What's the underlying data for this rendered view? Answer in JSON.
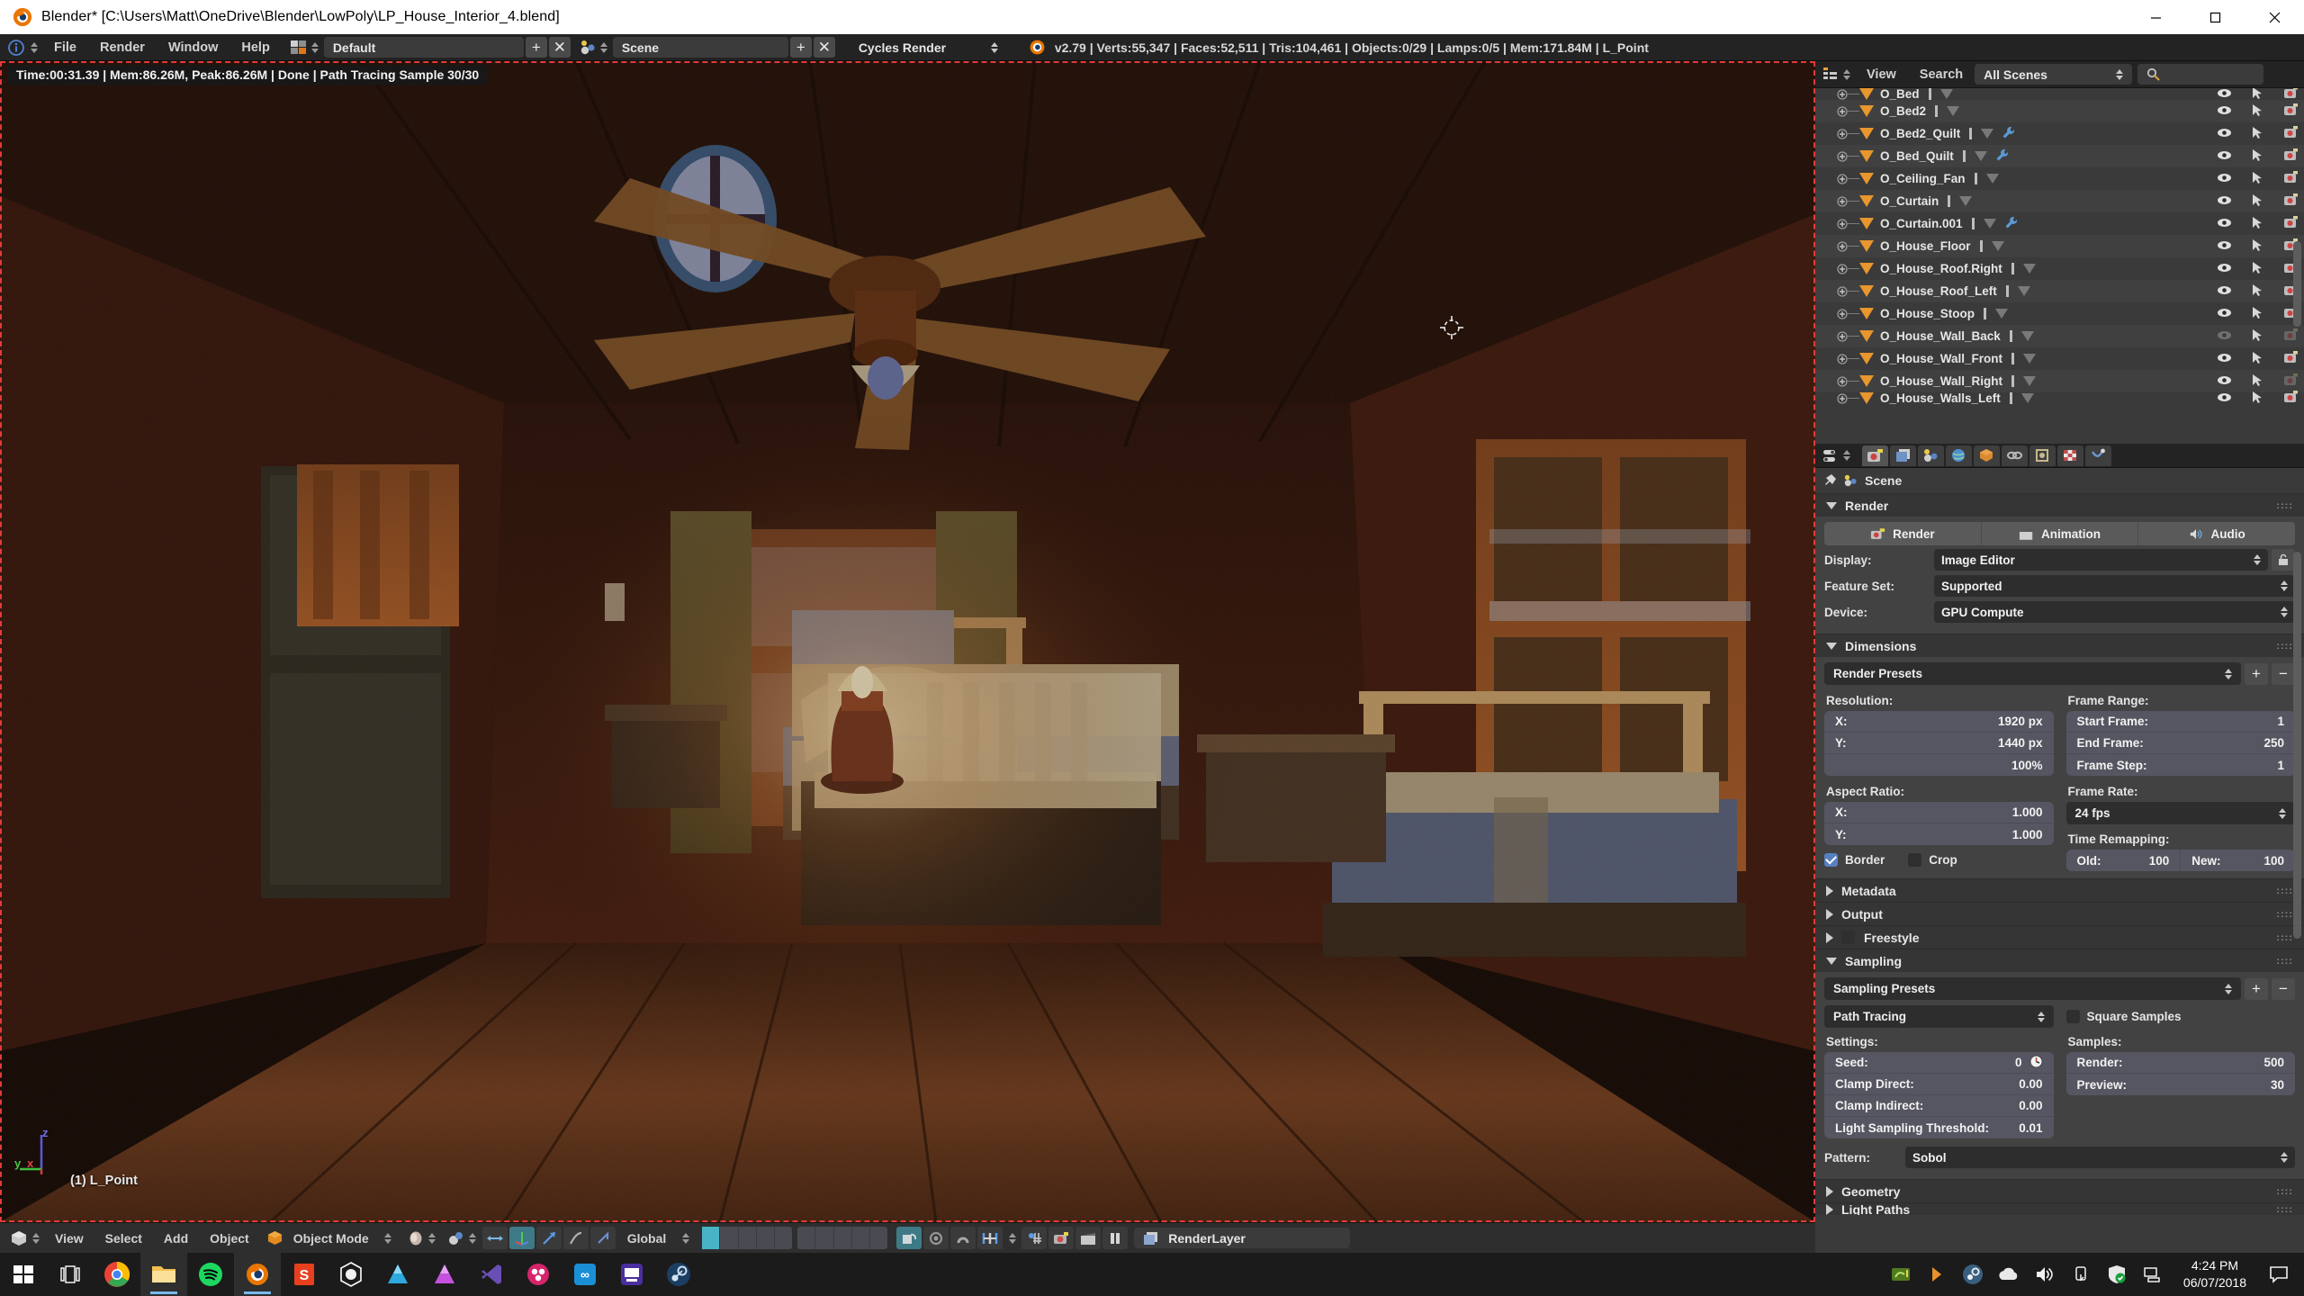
{
  "window": {
    "title": "Blender* [C:\\Users\\Matt\\OneDrive\\Blender\\LowPoly\\LP_House_Interior_4.blend]",
    "minimize": "—",
    "maximize": "☐",
    "close": "✕"
  },
  "topbar": {
    "menus": [
      "File",
      "Render",
      "Window",
      "Help"
    ],
    "screen_layout": "Default",
    "scene": "Scene",
    "engine": "Cycles Render",
    "add_label": "+",
    "remove_label": "✕",
    "stats": "v2.79 | Verts:55,347 | Faces:52,511 | Tris:104,461 | Objects:0/29 | Lamps:0/5 | Mem:171.84M | L_Point"
  },
  "viewport": {
    "render_info": "Time:00:31.39 | Mem:86.26M, Peak:86.26M | Done | Path Tracing Sample 30/30",
    "active_object": "(1) L_Point",
    "axis_labels": {
      "x": "x",
      "y": "y",
      "z": "z"
    },
    "header": {
      "menus": [
        "View",
        "Select",
        "Add",
        "Object"
      ],
      "mode": "Object Mode",
      "orientation": "Global",
      "render_layer": "RenderLayer"
    }
  },
  "outliner": {
    "header": {
      "view": "View",
      "search": "Search",
      "display_mode": "All Scenes",
      "search_placeholder": ""
    },
    "items": [
      {
        "name": "O_Bed",
        "modifier": false,
        "visible": true,
        "selectable": true,
        "renderable": true,
        "partial": true
      },
      {
        "name": "O_Bed2",
        "modifier": false,
        "visible": true,
        "selectable": true,
        "renderable": true
      },
      {
        "name": "O_Bed2_Quilt",
        "modifier": true,
        "visible": true,
        "selectable": true,
        "renderable": true
      },
      {
        "name": "O_Bed_Quilt",
        "modifier": true,
        "visible": true,
        "selectable": true,
        "renderable": true
      },
      {
        "name": "O_Ceiling_Fan",
        "modifier": false,
        "visible": true,
        "selectable": true,
        "renderable": true
      },
      {
        "name": "O_Curtain",
        "modifier": false,
        "visible": true,
        "selectable": true,
        "renderable": true
      },
      {
        "name": "O_Curtain.001",
        "modifier": true,
        "visible": true,
        "selectable": true,
        "renderable": true
      },
      {
        "name": "O_House_Floor",
        "modifier": false,
        "visible": true,
        "selectable": true,
        "renderable": true
      },
      {
        "name": "O_House_Roof.Right",
        "modifier": false,
        "visible": true,
        "selectable": true,
        "renderable": true
      },
      {
        "name": "O_House_Roof_Left",
        "modifier": false,
        "visible": true,
        "selectable": true,
        "renderable": true
      },
      {
        "name": "O_House_Stoop",
        "modifier": false,
        "visible": true,
        "selectable": true,
        "renderable": true
      },
      {
        "name": "O_House_Wall_Back",
        "modifier": false,
        "visible": false,
        "selectable": true,
        "renderable": false
      },
      {
        "name": "O_House_Wall_Front",
        "modifier": false,
        "visible": true,
        "selectable": true,
        "renderable": true
      },
      {
        "name": "O_House_Wall_Right",
        "modifier": false,
        "visible": true,
        "selectable": true,
        "renderable": false
      },
      {
        "name": "O_House_Walls_Left",
        "modifier": false,
        "visible": true,
        "selectable": true,
        "renderable": true,
        "partial": true
      }
    ]
  },
  "properties": {
    "context": "Scene",
    "tabs": [
      "render-tab",
      "render-layers-tab",
      "scene-tab",
      "world-tab",
      "object-tab",
      "constraints-tab",
      "modifiers-tab",
      "texture-tab",
      "physics-tab"
    ],
    "render": {
      "title": "Render",
      "buttons": [
        "Render",
        "Animation",
        "Audio"
      ],
      "display_label": "Display:",
      "display_value": "Image Editor",
      "feature_set_label": "Feature Set:",
      "feature_set_value": "Supported",
      "device_label": "Device:",
      "device_value": "GPU Compute"
    },
    "dimensions": {
      "title": "Dimensions",
      "presets": "Render Presets",
      "resolution_label": "Resolution:",
      "res_x_label": "X:",
      "res_x_value": "1920 px",
      "res_y_label": "Y:",
      "res_y_value": "1440 px",
      "res_percent": "100%",
      "aspect_label": "Aspect Ratio:",
      "aspect_x_label": "X:",
      "aspect_x_value": "1.000",
      "aspect_y_label": "Y:",
      "aspect_y_value": "1.000",
      "border_label": "Border",
      "border_checked": true,
      "crop_label": "Crop",
      "crop_checked": false,
      "frame_range_label": "Frame Range:",
      "start_frame_label": "Start Frame:",
      "start_frame_value": "1",
      "end_frame_label": "End Frame:",
      "end_frame_value": "250",
      "frame_step_label": "Frame Step:",
      "frame_step_value": "1",
      "frame_rate_label": "Frame Rate:",
      "frame_rate_value": "24 fps",
      "time_remap_label": "Time Remapping:",
      "old_label": "Old:",
      "old_value": "100",
      "new_label": "New:",
      "new_value": "100"
    },
    "collapsed": [
      {
        "title": "Metadata",
        "checkbox": false
      },
      {
        "title": "Output",
        "checkbox": false
      },
      {
        "title": "Freestyle",
        "checkbox": true
      }
    ],
    "sampling": {
      "title": "Sampling",
      "presets": "Sampling Presets",
      "integrator": "Path Tracing",
      "square_samples_label": "Square Samples",
      "settings_label": "Settings:",
      "seed_label": "Seed:",
      "seed_value": "0",
      "clamp_direct_label": "Clamp Direct:",
      "clamp_direct_value": "0.00",
      "clamp_indirect_label": "Clamp Indirect:",
      "clamp_indirect_value": "0.00",
      "light_threshold_label": "Light Sampling Threshold:",
      "light_threshold_value": "0.01",
      "samples_label": "Samples:",
      "render_samples_label": "Render:",
      "render_samples_value": "500",
      "preview_samples_label": "Preview:",
      "preview_samples_value": "30",
      "pattern_label": "Pattern:",
      "pattern_value": "Sobol"
    },
    "geometry": {
      "title": "Geometry"
    },
    "light_paths": {
      "title": "Light Paths"
    }
  },
  "taskbar": {
    "apps": [
      "start-icon",
      "task-view-icon",
      "chrome-icon",
      "file-explorer-icon",
      "spotify-icon",
      "blender-icon",
      "substance-icon",
      "unreal-icon",
      "affinity-designer-icon",
      "affinity-photo-icon",
      "visual-studio-code-icon",
      "octane-icon",
      "coolors-icon",
      "store-icon",
      "steam-icon"
    ],
    "tray": [
      "nvidia-icon",
      "utorrent-icon",
      "steam-tray-icon",
      "onedrive-icon",
      "volume-icon",
      "usb-icon",
      "defender-icon",
      "network-icon"
    ],
    "time": "4:24 PM",
    "date": "06/07/2018",
    "notifications": "notification-icon"
  },
  "colors": {
    "accent_orange": "#e8962e",
    "blender_bg": "#2b2b2b",
    "panel_bg": "#424242",
    "header_bg": "#232323",
    "render_border": "#e23b3b",
    "highlight_blue": "#5680c2"
  }
}
